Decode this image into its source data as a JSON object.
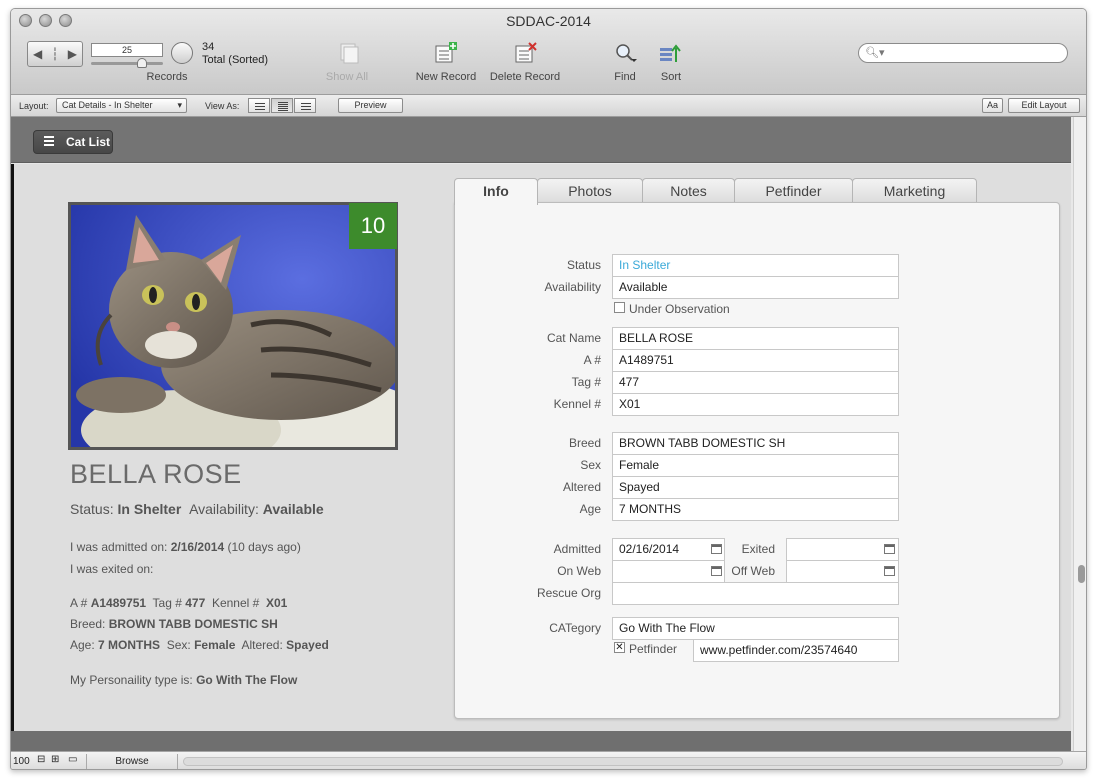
{
  "window": {
    "title": "SDDAC-2014"
  },
  "toolbar": {
    "record_number": "25",
    "total_count": "34",
    "total_label": "Total (Sorted)",
    "records_label": "Records",
    "show_all": "Show All",
    "new_record": "New Record",
    "delete_record": "Delete Record",
    "find": "Find",
    "sort": "Sort",
    "search_placeholder": ""
  },
  "layoutbar": {
    "layout_label": "Layout:",
    "layout_value": "Cat Details - In Shelter",
    "view_as_label": "View As:",
    "preview": "Preview",
    "aa": "Aa",
    "edit_layout": "Edit Layout"
  },
  "header": {
    "cat_list_button": "Cat List"
  },
  "summary": {
    "kennel_badge": "10",
    "cat_name": "BELLA ROSE",
    "status_label": "Status:",
    "status_value": "In Shelter",
    "availability_label": "Availability:",
    "availability_value": "Available",
    "admitted_prefix": "I was admitted on:",
    "admitted_date": "2/16/2014",
    "admitted_ago": "(10 days ago)",
    "exited_prefix": "I was exited on:",
    "a_label": "A #",
    "a_value": "A1489751",
    "tag_label": "Tag #",
    "tag_value": "477",
    "kennel_label": "Kennel #",
    "kennel_value": "X01",
    "breed_label": "Breed:",
    "breed_value": "BROWN TABB DOMESTIC SH",
    "age_label": "Age:",
    "age_value": "7 MONTHS",
    "sex_label": "Sex:",
    "sex_value": "Female",
    "altered_label": "Altered:",
    "altered_value": "Spayed",
    "personality_label": "My Personaility type is:",
    "personality_value": "Go With The Flow"
  },
  "tabs": [
    "Info",
    "Photos",
    "Notes",
    "Petfinder",
    "Marketing"
  ],
  "form": {
    "status_label": "Status",
    "status": "In Shelter",
    "availability_label": "Availability",
    "availability": "Available",
    "under_observation": "Under Observation",
    "cat_name_label": "Cat Name",
    "cat_name": "BELLA ROSE",
    "a_label": "A #",
    "a_number": "A1489751",
    "tag_label": "Tag #",
    "tag": "477",
    "kennel_label": "Kennel #",
    "kennel": "X01",
    "breed_label": "Breed",
    "breed": "BROWN TABB DOMESTIC SH",
    "sex_label": "Sex",
    "sex": "Female",
    "altered_label": "Altered",
    "altered": "Spayed",
    "age_label": "Age",
    "age": "7 MONTHS",
    "admitted_label": "Admitted",
    "admitted": "02/16/2014",
    "exited_label": "Exited",
    "exited": "",
    "on_web_label": "On Web",
    "on_web": "",
    "off_web_label": "Off Web",
    "off_web": "",
    "rescue_org_label": "Rescue Org",
    "rescue_org": "",
    "category_label": "CATegory",
    "category": "Go With The Flow",
    "petfinder_label": "Petfinder",
    "petfinder_checked": "✕",
    "petfinder_url": "www.petfinder.com/23574640"
  },
  "statusbar": {
    "zoom": "100",
    "mode": "Browse"
  },
  "colors": {
    "status_link": "#3aa9d8",
    "badge": "#3d8b2c"
  }
}
